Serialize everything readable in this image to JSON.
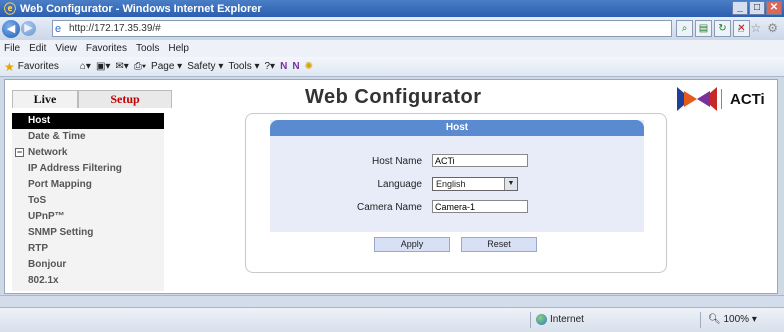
{
  "window": {
    "title": "Web Configurator - Windows Internet Explorer",
    "icon": "ie-icon"
  },
  "browser": {
    "address": "http://172.17.35.39/#",
    "menu": [
      "File",
      "Edit",
      "View",
      "Favorites",
      "Tools",
      "Help"
    ],
    "favorites_label": "Favorites",
    "commands": [
      "Page ▾",
      "Safety ▾",
      "Tools ▾"
    ]
  },
  "page": {
    "tabs": {
      "live": "Live",
      "setup": "Setup"
    },
    "banner_title": "Web Configurator",
    "brand": "ACTi",
    "sidebar": [
      {
        "label": "Host",
        "active": true
      },
      {
        "label": "Date & Time"
      },
      {
        "label": "Network",
        "group": true
      },
      {
        "label": "IP Address Filtering"
      },
      {
        "label": "Port Mapping"
      },
      {
        "label": "ToS"
      },
      {
        "label": "UPnP™"
      },
      {
        "label": "SNMP Setting"
      },
      {
        "label": "RTP"
      },
      {
        "label": "Bonjour"
      },
      {
        "label": "802.1x"
      }
    ],
    "form": {
      "title": "Host",
      "host_name_label": "Host Name",
      "host_name_value": "ACTi",
      "language_label": "Language",
      "language_value": "English",
      "camera_name_label": "Camera Name",
      "camera_name_value": "Camera-1",
      "apply_label": "Apply",
      "reset_label": "Reset"
    }
  },
  "status": {
    "zone": "Internet",
    "zoom": "100%"
  },
  "colors": {
    "setup_tab": "#c00000",
    "form_header": "#5a8ad0",
    "form_bg": "#e8ecf9",
    "active_item": "#000000"
  }
}
